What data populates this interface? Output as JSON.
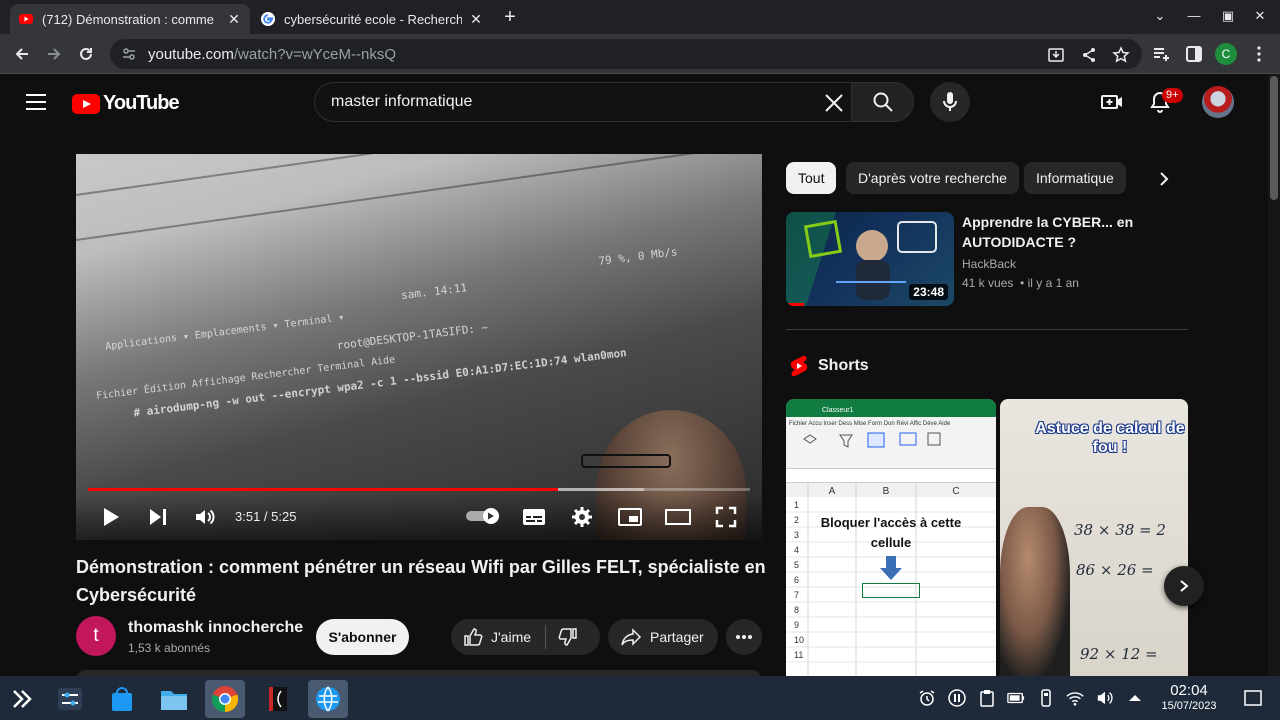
{
  "browser": {
    "tabs": [
      {
        "title": "(712) Démonstration : comme",
        "active": true
      },
      {
        "title": "cybersécurité ecole - Recherch",
        "active": false
      }
    ],
    "address": {
      "host": "youtube.com",
      "path": "/watch?v=wYceM--nksQ"
    },
    "profile_initial": "C"
  },
  "header": {
    "logo_text": "YouTube",
    "search_value": "master informatique",
    "notification_count": "9+"
  },
  "player": {
    "current_time": "3:51",
    "duration": "5:25",
    "progress_fraction": 0.71,
    "loaded_fraction": 0.84,
    "frame_text": {
      "menu": "Applications ▾    Emplacements ▾    Terminal ▾",
      "clock": "sam. 14:11",
      "status": "79 %, 0 Mb/s",
      "window_title": "root@DESKTOP-1TASIFD: ~",
      "terminal_menu": "Fichier   Édition   Affichage   Rechercher   Terminal   Aide",
      "command": "# airodump-ng -w out --encrypt wpa2 -c 1 --bssid E0:A1:D7:EC:1D:74 wlan0mon"
    }
  },
  "video": {
    "title": "Démonstration : comment pénétrer un réseau Wifi par Gilles FELT, spécialiste en Cybersécurité",
    "channel_initial": "t",
    "channel_name": "thomashk innocherche",
    "subscribers": "1,53 k abonnés",
    "subscribe_label": "S'abonner",
    "like_label": "J'aime",
    "share_label": "Partager"
  },
  "sidebar": {
    "chips": [
      "Tout",
      "D'après votre recherche",
      "Informatique"
    ],
    "recommendation": {
      "title": "Apprendre la CYBER... en AUTODIDACTE ?",
      "channel": "HackBack",
      "views": "41 k vues",
      "age": "il y a 1 an",
      "duration": "23:48"
    },
    "shorts_label": "Shorts",
    "shorts": [
      {
        "app_title": "Classeur1",
        "menu": "Fichier  Accu  Inser  Dess  Mise  Form  Don  Révi  Affic  Déve  Aide",
        "columns": [
          "A",
          "B",
          "C"
        ],
        "rows": [
          "1",
          "2",
          "3",
          "4",
          "5",
          "6",
          "7",
          "8",
          "9",
          "10",
          "11"
        ],
        "cell_text": "Bloquer l'accès à cette cellule"
      },
      {
        "caption": "Astuce de calcul de fou !",
        "equations": [
          "38 × 38 = 2",
          "86 × 26 =",
          "92 × 12 ="
        ]
      }
    ]
  },
  "taskbar": {
    "time": "02:04",
    "date": "15/07/2023"
  },
  "colors": {
    "youtube_red": "#ff0000",
    "page_bg": "#0f0f0f",
    "chip_bg": "#272727"
  }
}
